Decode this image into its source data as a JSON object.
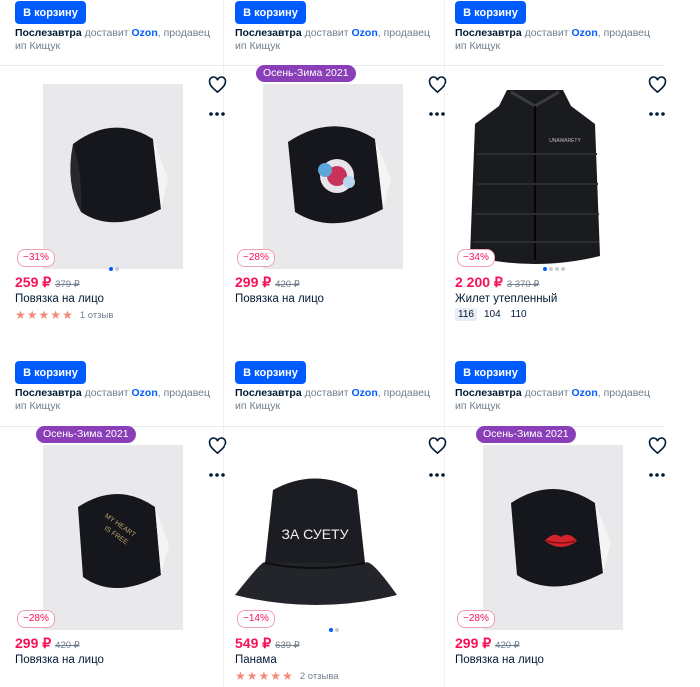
{
  "buttons": {
    "cart": "В корзину"
  },
  "delivery": {
    "when": "Послезавтра",
    "by_prefix": "доставит",
    "ozon": "Ozon",
    "seller_prefix": ", продавец ип",
    "seller": "Кищук"
  },
  "products": [
    {
      "title": "Повязка на лицо",
      "price": "259 ₽",
      "old_price": "379 ₽",
      "discount": "−31%",
      "season": "",
      "rating_stars": 5,
      "reviews": "1 отзыв",
      "sizes": [],
      "image": "black-face-mask",
      "slides": 2,
      "active_slide": 1
    },
    {
      "title": "Повязка на лицо",
      "price": "299 ₽",
      "old_price": "420 ₽",
      "discount": "−28%",
      "season": "Осень-Зима 2021",
      "rating_stars": 0,
      "reviews": "",
      "sizes": [],
      "image": "black-face-mask-rose-print",
      "slides": 0,
      "active_slide": 0
    },
    {
      "title": "Жилет утепленный",
      "price": "2 200 ₽",
      "old_price": "3 370 ₽",
      "discount": "−34%",
      "season": "",
      "rating_stars": 0,
      "reviews": "",
      "sizes": [
        "116",
        "104",
        "110"
      ],
      "image": "black-puffer-vest",
      "slides": 4,
      "active_slide": 1
    },
    {
      "title": "Повязка на лицо",
      "price": "299 ₽",
      "old_price": "420 ₽",
      "discount": "−28%",
      "season": "Осень-Зима 2021",
      "rating_stars": 0,
      "reviews": "",
      "sizes": [],
      "image": "black-face-mask-text-print",
      "slides": 0,
      "active_slide": 0
    },
    {
      "title": "Панама",
      "price": "549 ₽",
      "old_price": "639 ₽",
      "discount": "−14%",
      "season": "",
      "rating_stars": 5,
      "reviews": "2 отзыва",
      "sizes": [],
      "image": "black-bucket-hat",
      "slides": 2,
      "active_slide": 1
    },
    {
      "title": "Повязка на лицо",
      "price": "299 ₽",
      "old_price": "420 ₽",
      "discount": "−28%",
      "season": "Осень-Зима 2021",
      "rating_stars": 0,
      "reviews": "",
      "sizes": [],
      "image": "black-face-mask-lips-print",
      "slides": 0,
      "active_slide": 0
    }
  ],
  "image_text": {
    "vest_label": "UNAWARETY",
    "mask_text_print": [
      "MY HEART",
      "IS FREE"
    ],
    "hat_print": "ЗА СУЕТУ"
  },
  "colors": {
    "accent": "#005bff",
    "price": "#f91155",
    "season_badge": "#8a3fb8",
    "star": "#f48a7a"
  }
}
